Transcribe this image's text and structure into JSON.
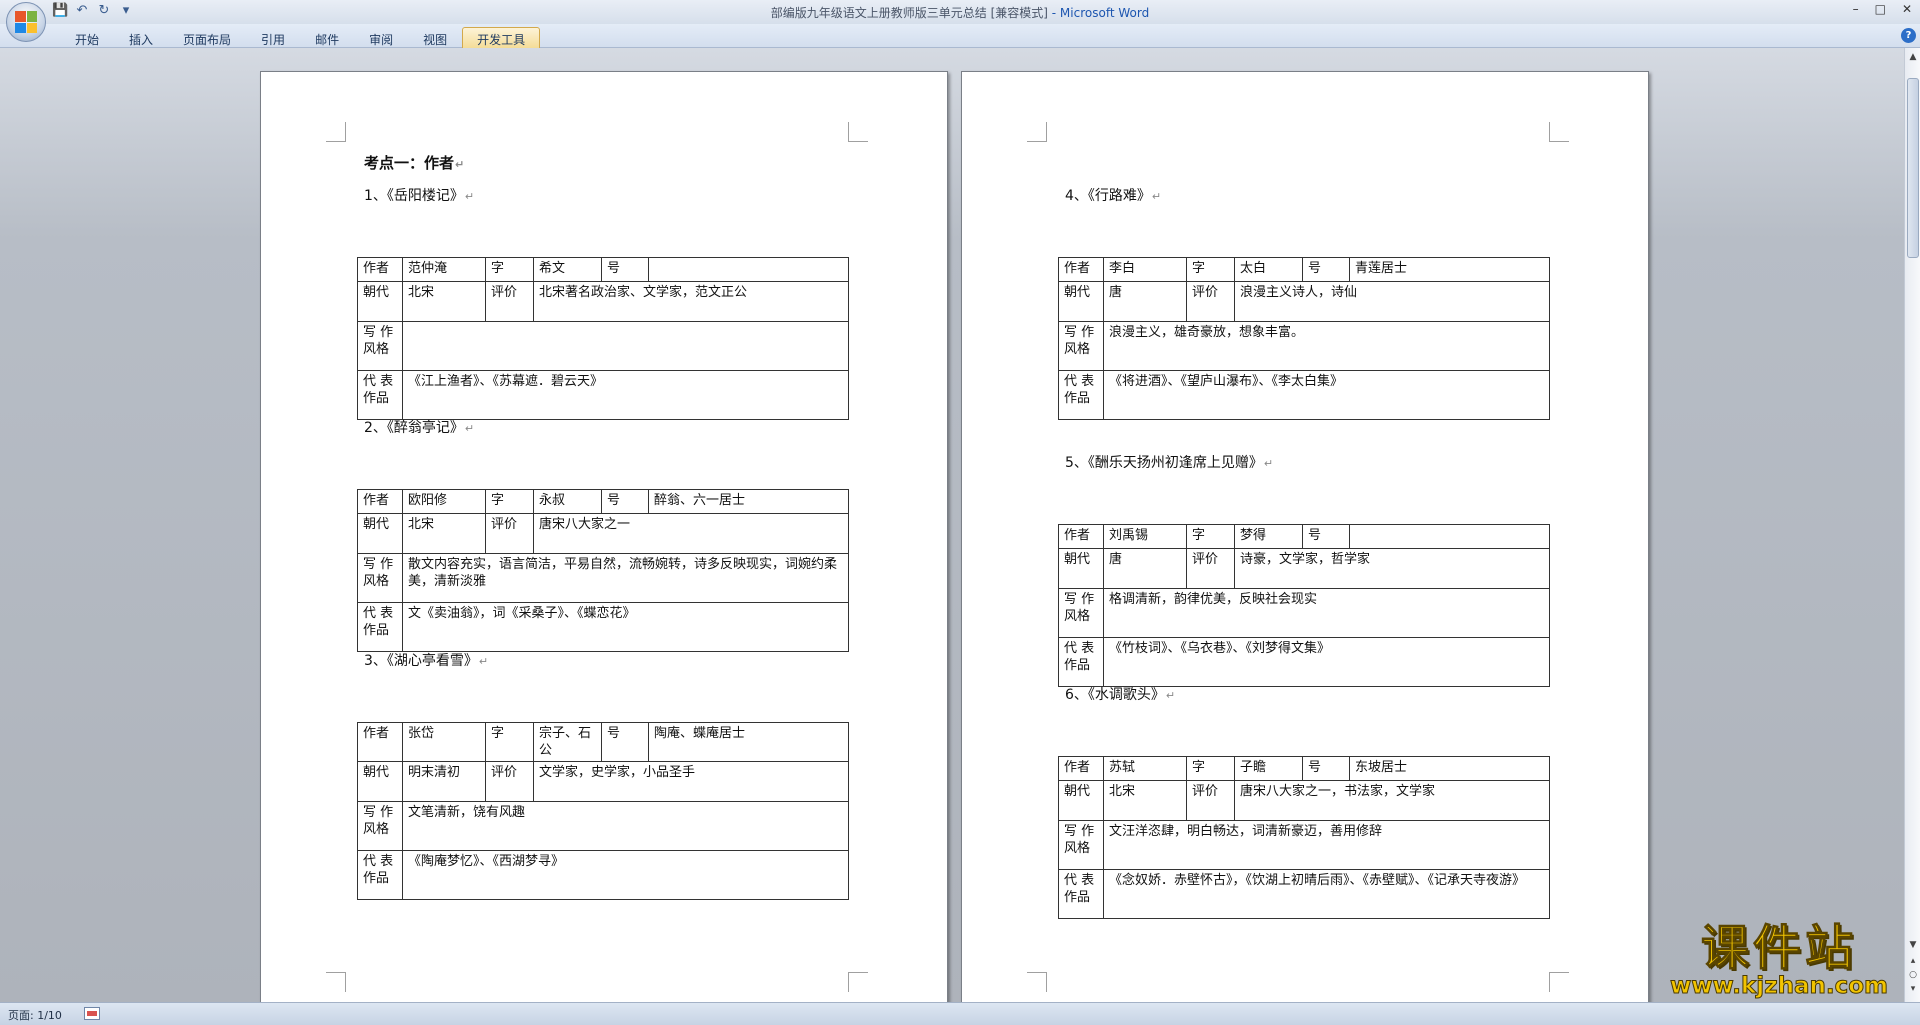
{
  "window": {
    "title": "部编版九年级语文上册教师版三单元总结 [兼容模式]",
    "app_suffix": " - Microsoft Word",
    "controls": [
      "–",
      "□",
      "✕"
    ]
  },
  "qat": {
    "save_icon": "💾",
    "undo_icon": "↶",
    "redo_icon": "↻",
    "more_icon": "▾"
  },
  "ribbon": {
    "tabs": [
      "开始",
      "插入",
      "页面布局",
      "引用",
      "邮件",
      "审阅",
      "视图",
      "开发工具"
    ],
    "active_tab": "开发工具",
    "help": "?"
  },
  "page1": {
    "heading": "考点一：作者",
    "sections": [
      {
        "title": "1、《岳阳楼记》",
        "row1": [
          "作者",
          "范仲淹",
          "字",
          "希文",
          "号",
          ""
        ],
        "row2": [
          "朝代",
          "北宋",
          "评价",
          "北宋著名政治家、文学家，范文正公"
        ],
        "row3": [
          "写 作 风格",
          ""
        ],
        "row4": [
          "代 表 作品",
          "《江上渔者》、《苏幕遮．碧云天》"
        ]
      },
      {
        "title": "2、《醉翁亭记》",
        "row1": [
          "作者",
          "欧阳修",
          "字",
          "永叔",
          "号",
          "醉翁、六一居士"
        ],
        "row2": [
          "朝代",
          "北宋",
          "评价",
          "唐宋八大家之一"
        ],
        "row3": [
          "写 作 风格",
          "散文内容充实，语言简洁，平易自然，流畅婉转，诗多反映现实，词婉约柔美，清新淡雅"
        ],
        "row4": [
          "代 表 作品",
          "文《卖油翁》，词《采桑子》、《蝶恋花》"
        ]
      },
      {
        "title": "3、《湖心亭看雪》",
        "row1": [
          "作者",
          "张岱",
          "字",
          "宗子、石公",
          "号",
          "陶庵、蝶庵居士"
        ],
        "row2": [
          "朝代",
          "明末清初",
          "评价",
          "文学家，史学家，小品圣手"
        ],
        "row3": [
          "写 作 风格",
          "文笔清新，饶有风趣"
        ],
        "row4": [
          "代 表 作品",
          "《陶庵梦忆》、《西湖梦寻》"
        ]
      }
    ]
  },
  "page2": {
    "sections": [
      {
        "title": "4、《行路难》",
        "row1": [
          "作者",
          "李白",
          "字",
          "太白",
          "号",
          "青莲居士"
        ],
        "row2": [
          "朝代",
          "唐",
          "评价",
          "浪漫主义诗人，诗仙"
        ],
        "row3": [
          "写 作 风格",
          "浪漫主义，雄奇豪放，想象丰富。"
        ],
        "row4": [
          "代 表 作品",
          "《将进酒》、《望庐山瀑布》、《李太白集》"
        ]
      },
      {
        "title": "5、《酬乐天扬州初逢席上见赠》",
        "row1": [
          "作者",
          "刘禹锡",
          "字",
          "梦得",
          "号",
          ""
        ],
        "row2": [
          "朝代",
          "唐",
          "评价",
          "诗豪，文学家，哲学家"
        ],
        "row3": [
          "写 作 风格",
          "格调清新，韵律优美，反映社会现实"
        ],
        "row4": [
          "代 表 作品",
          "《竹枝词》、《乌衣巷》、《刘梦得文集》"
        ]
      },
      {
        "title": "6、《水调歌头》",
        "row1": [
          "作者",
          "苏轼",
          "字",
          "子瞻",
          "号",
          "东坡居士"
        ],
        "row2": [
          "朝代",
          "北宋",
          "评价",
          "唐宋八大家之一，书法家，文学家"
        ],
        "row3": [
          "写 作 风格",
          "文汪洋恣肆，明白畅达，词清新豪迈，善用修辞"
        ],
        "row4": [
          "代 表 作品",
          "《念奴娇．赤壁怀古》，《饮湖上初晴后雨》、《赤壁赋》、《记承天寺夜游》"
        ]
      }
    ]
  },
  "status": {
    "page": "页面: 1/10"
  },
  "watermark": {
    "main": "课件站",
    "url": "www.kjzhan.com"
  },
  "colors": {
    "accent": "#1d56b0",
    "watermark": "#f2c400",
    "active_tab": "#f3d98e"
  }
}
